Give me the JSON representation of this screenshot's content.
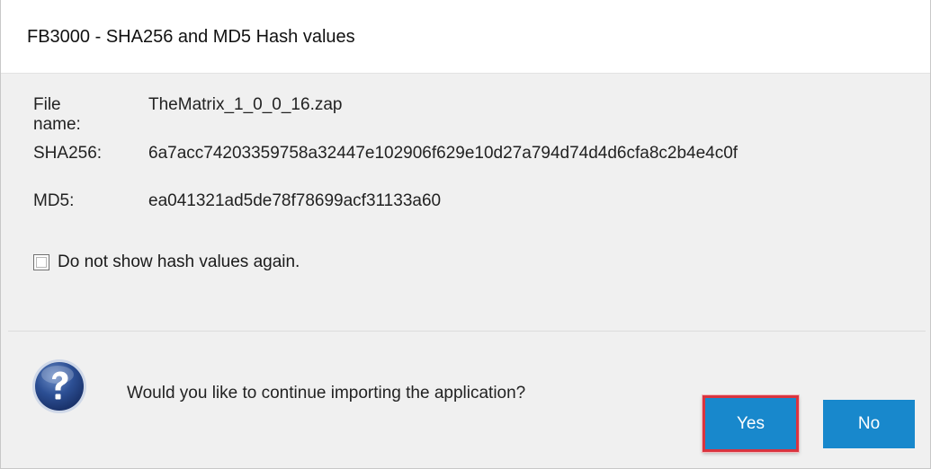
{
  "window": {
    "title": "FB3000 - SHA256 and MD5 Hash values"
  },
  "file_info": {
    "file_name_label": "File name:",
    "file_name_value": "TheMatrix_1_0_0_16.zap",
    "sha256_label": "SHA256:",
    "sha256_value": "6a7acc74203359758a32447e102906f629e10d27a794d74d4d6cfa8c2b4e4c0f",
    "md5_label": "MD5:",
    "md5_value": "ea041321ad5de78f78699acf31133a60"
  },
  "checkbox": {
    "label": "Do not show hash values again.",
    "checked": false
  },
  "prompt": {
    "icon": "question-icon",
    "text": "Would you like to continue importing the application?"
  },
  "buttons": {
    "yes_label": "Yes",
    "no_label": "No"
  },
  "colors": {
    "button_bg": "#1888cc",
    "highlight_border": "#d9343f",
    "dialog_bg": "#f0f0f0"
  }
}
